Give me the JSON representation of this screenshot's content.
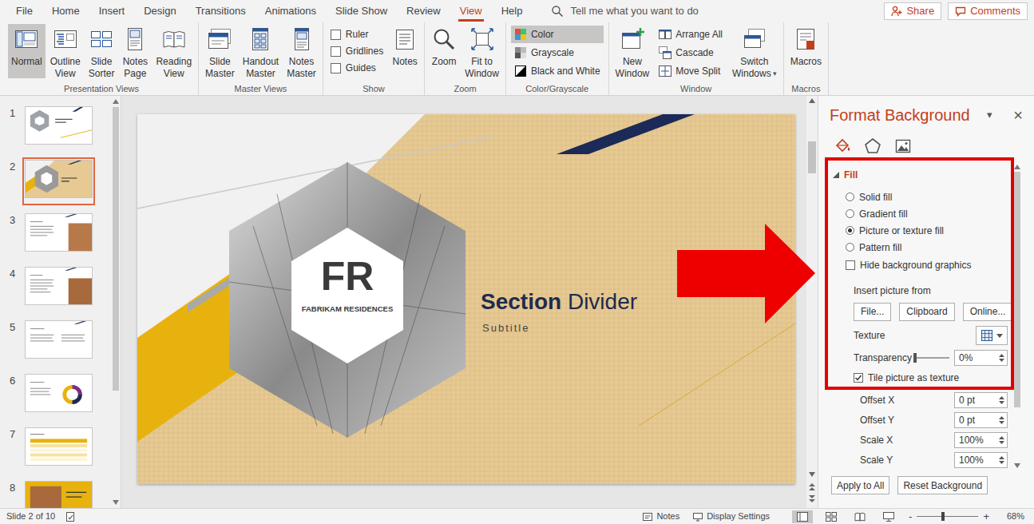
{
  "ribbon_tabs": [
    {
      "label": "File",
      "selected": false
    },
    {
      "label": "Home",
      "selected": false
    },
    {
      "label": "Insert",
      "selected": false
    },
    {
      "label": "Design",
      "selected": false
    },
    {
      "label": "Transitions",
      "selected": false
    },
    {
      "label": "Animations",
      "selected": false
    },
    {
      "label": "Slide Show",
      "selected": false
    },
    {
      "label": "Review",
      "selected": false
    },
    {
      "label": "View",
      "selected": true
    },
    {
      "label": "Help",
      "selected": false
    }
  ],
  "tell_me": "Tell me what you want to do",
  "header_buttons": [
    {
      "label": "Share"
    },
    {
      "label": "Comments"
    }
  ],
  "ribbon_groups": [
    {
      "label": "Presentation Views",
      "items": [
        {
          "kind": "large",
          "lines": [
            "Normal"
          ],
          "selected": true
        },
        {
          "kind": "large",
          "lines": [
            "Outline",
            "View"
          ],
          "selected": false
        },
        {
          "kind": "large",
          "lines": [
            "Slide",
            "Sorter"
          ],
          "selected": false
        },
        {
          "kind": "large",
          "lines": [
            "Notes",
            "Page"
          ],
          "selected": false
        },
        {
          "kind": "large",
          "lines": [
            "Reading",
            "View"
          ],
          "selected": false
        }
      ]
    },
    {
      "label": "Master Views",
      "items": [
        {
          "kind": "large",
          "lines": [
            "Slide",
            "Master"
          ],
          "selected": false
        },
        {
          "kind": "large",
          "lines": [
            "Handout",
            "Master"
          ],
          "selected": false
        },
        {
          "kind": "large",
          "lines": [
            "Notes",
            "Master"
          ],
          "selected": false
        }
      ]
    },
    {
      "label": "Show",
      "items": [
        {
          "kind": "check",
          "label": "Ruler",
          "checked": false
        },
        {
          "kind": "check",
          "label": "Gridlines",
          "checked": false
        },
        {
          "kind": "check",
          "label": "Guides",
          "checked": false
        },
        {
          "kind": "large",
          "lines": [
            "Notes"
          ],
          "selected": false
        }
      ]
    },
    {
      "label": "Zoom",
      "items": [
        {
          "kind": "large",
          "lines": [
            "Zoom"
          ],
          "selected": false
        },
        {
          "kind": "large",
          "lines": [
            "Fit to",
            "Window"
          ],
          "selected": false
        }
      ]
    },
    {
      "label": "Color/Grayscale",
      "items": [
        {
          "kind": "small",
          "label": "Color",
          "selected": true
        },
        {
          "kind": "small",
          "label": "Grayscale",
          "selected": false
        },
        {
          "kind": "small",
          "label": "Black and White",
          "selected": false
        }
      ]
    },
    {
      "label": "Window",
      "items": [
        {
          "kind": "large",
          "lines": [
            "New",
            "Window"
          ],
          "selected": false
        },
        {
          "kind": "small",
          "label": "Arrange All",
          "selected": false
        },
        {
          "kind": "small",
          "label": "Cascade",
          "selected": false
        },
        {
          "kind": "small",
          "label": "Move Split",
          "selected": false
        },
        {
          "kind": "large",
          "lines": [
            "Switch",
            "Windows"
          ],
          "caret": "▾",
          "selected": false
        }
      ]
    },
    {
      "label": "Macros",
      "items": [
        {
          "kind": "large",
          "lines": [
            "Macros"
          ],
          "selected": false
        }
      ]
    }
  ],
  "thumbnails": [
    {
      "number": "1",
      "selected": false
    },
    {
      "number": "2",
      "selected": true
    },
    {
      "number": "3",
      "selected": false
    },
    {
      "number": "4",
      "selected": false
    },
    {
      "number": "5",
      "selected": false
    },
    {
      "number": "6",
      "selected": false
    },
    {
      "number": "7",
      "selected": false
    },
    {
      "number": "8",
      "selected": false
    }
  ],
  "slide": {
    "logo_main": "FR",
    "logo_sub": "FABRIKAM RESIDENCES",
    "title": [
      {
        "text": "Section",
        "bold": true
      },
      {
        "text": " Divider",
        "bold": false
      }
    ],
    "subtitle": "Subtitle"
  },
  "format_pane": {
    "title": "Format Background",
    "menu_caret": "▾",
    "close": "×",
    "tabs": [
      {
        "selected": true
      },
      {
        "selected": false
      },
      {
        "selected": false
      }
    ],
    "section": {
      "label": "Fill",
      "expanded": true
    },
    "fill_options": [
      {
        "label": "Solid fill",
        "selected": false
      },
      {
        "label": "Gradient fill",
        "selected": false
      },
      {
        "label": "Picture or texture fill",
        "selected": true
      },
      {
        "label": "Pattern fill",
        "selected": false
      }
    ],
    "hide_background": {
      "label": "Hide background graphics",
      "checked": false
    },
    "insert_picture": {
      "label": "Insert picture from",
      "buttons": [
        "File...",
        "Clipboard",
        "Online..."
      ]
    },
    "texture": {
      "label": "Texture"
    },
    "transparency": {
      "label": "Transparency",
      "level": 0,
      "value": "0%"
    },
    "tile": {
      "label": "Tile picture as texture",
      "checked": true
    },
    "fields": [
      {
        "label": "Offset X",
        "value": "0 pt"
      },
      {
        "label": "Offset Y",
        "value": "0 pt"
      },
      {
        "label": "Scale X",
        "value": "100%"
      },
      {
        "label": "Scale Y",
        "value": "100%"
      }
    ],
    "buttons": [
      "Apply to All",
      "Reset Background"
    ]
  },
  "status_bar": {
    "slide_info": "Slide 2 of 10",
    "notes": "Notes",
    "display_settings": "Display Settings",
    "views": [
      {
        "selected": true
      },
      {
        "selected": false
      },
      {
        "selected": false
      },
      {
        "selected": false
      }
    ],
    "zoom_minus": "-",
    "zoom_plus": "+",
    "zoom_level": 0.42,
    "zoom_value": "68%"
  }
}
